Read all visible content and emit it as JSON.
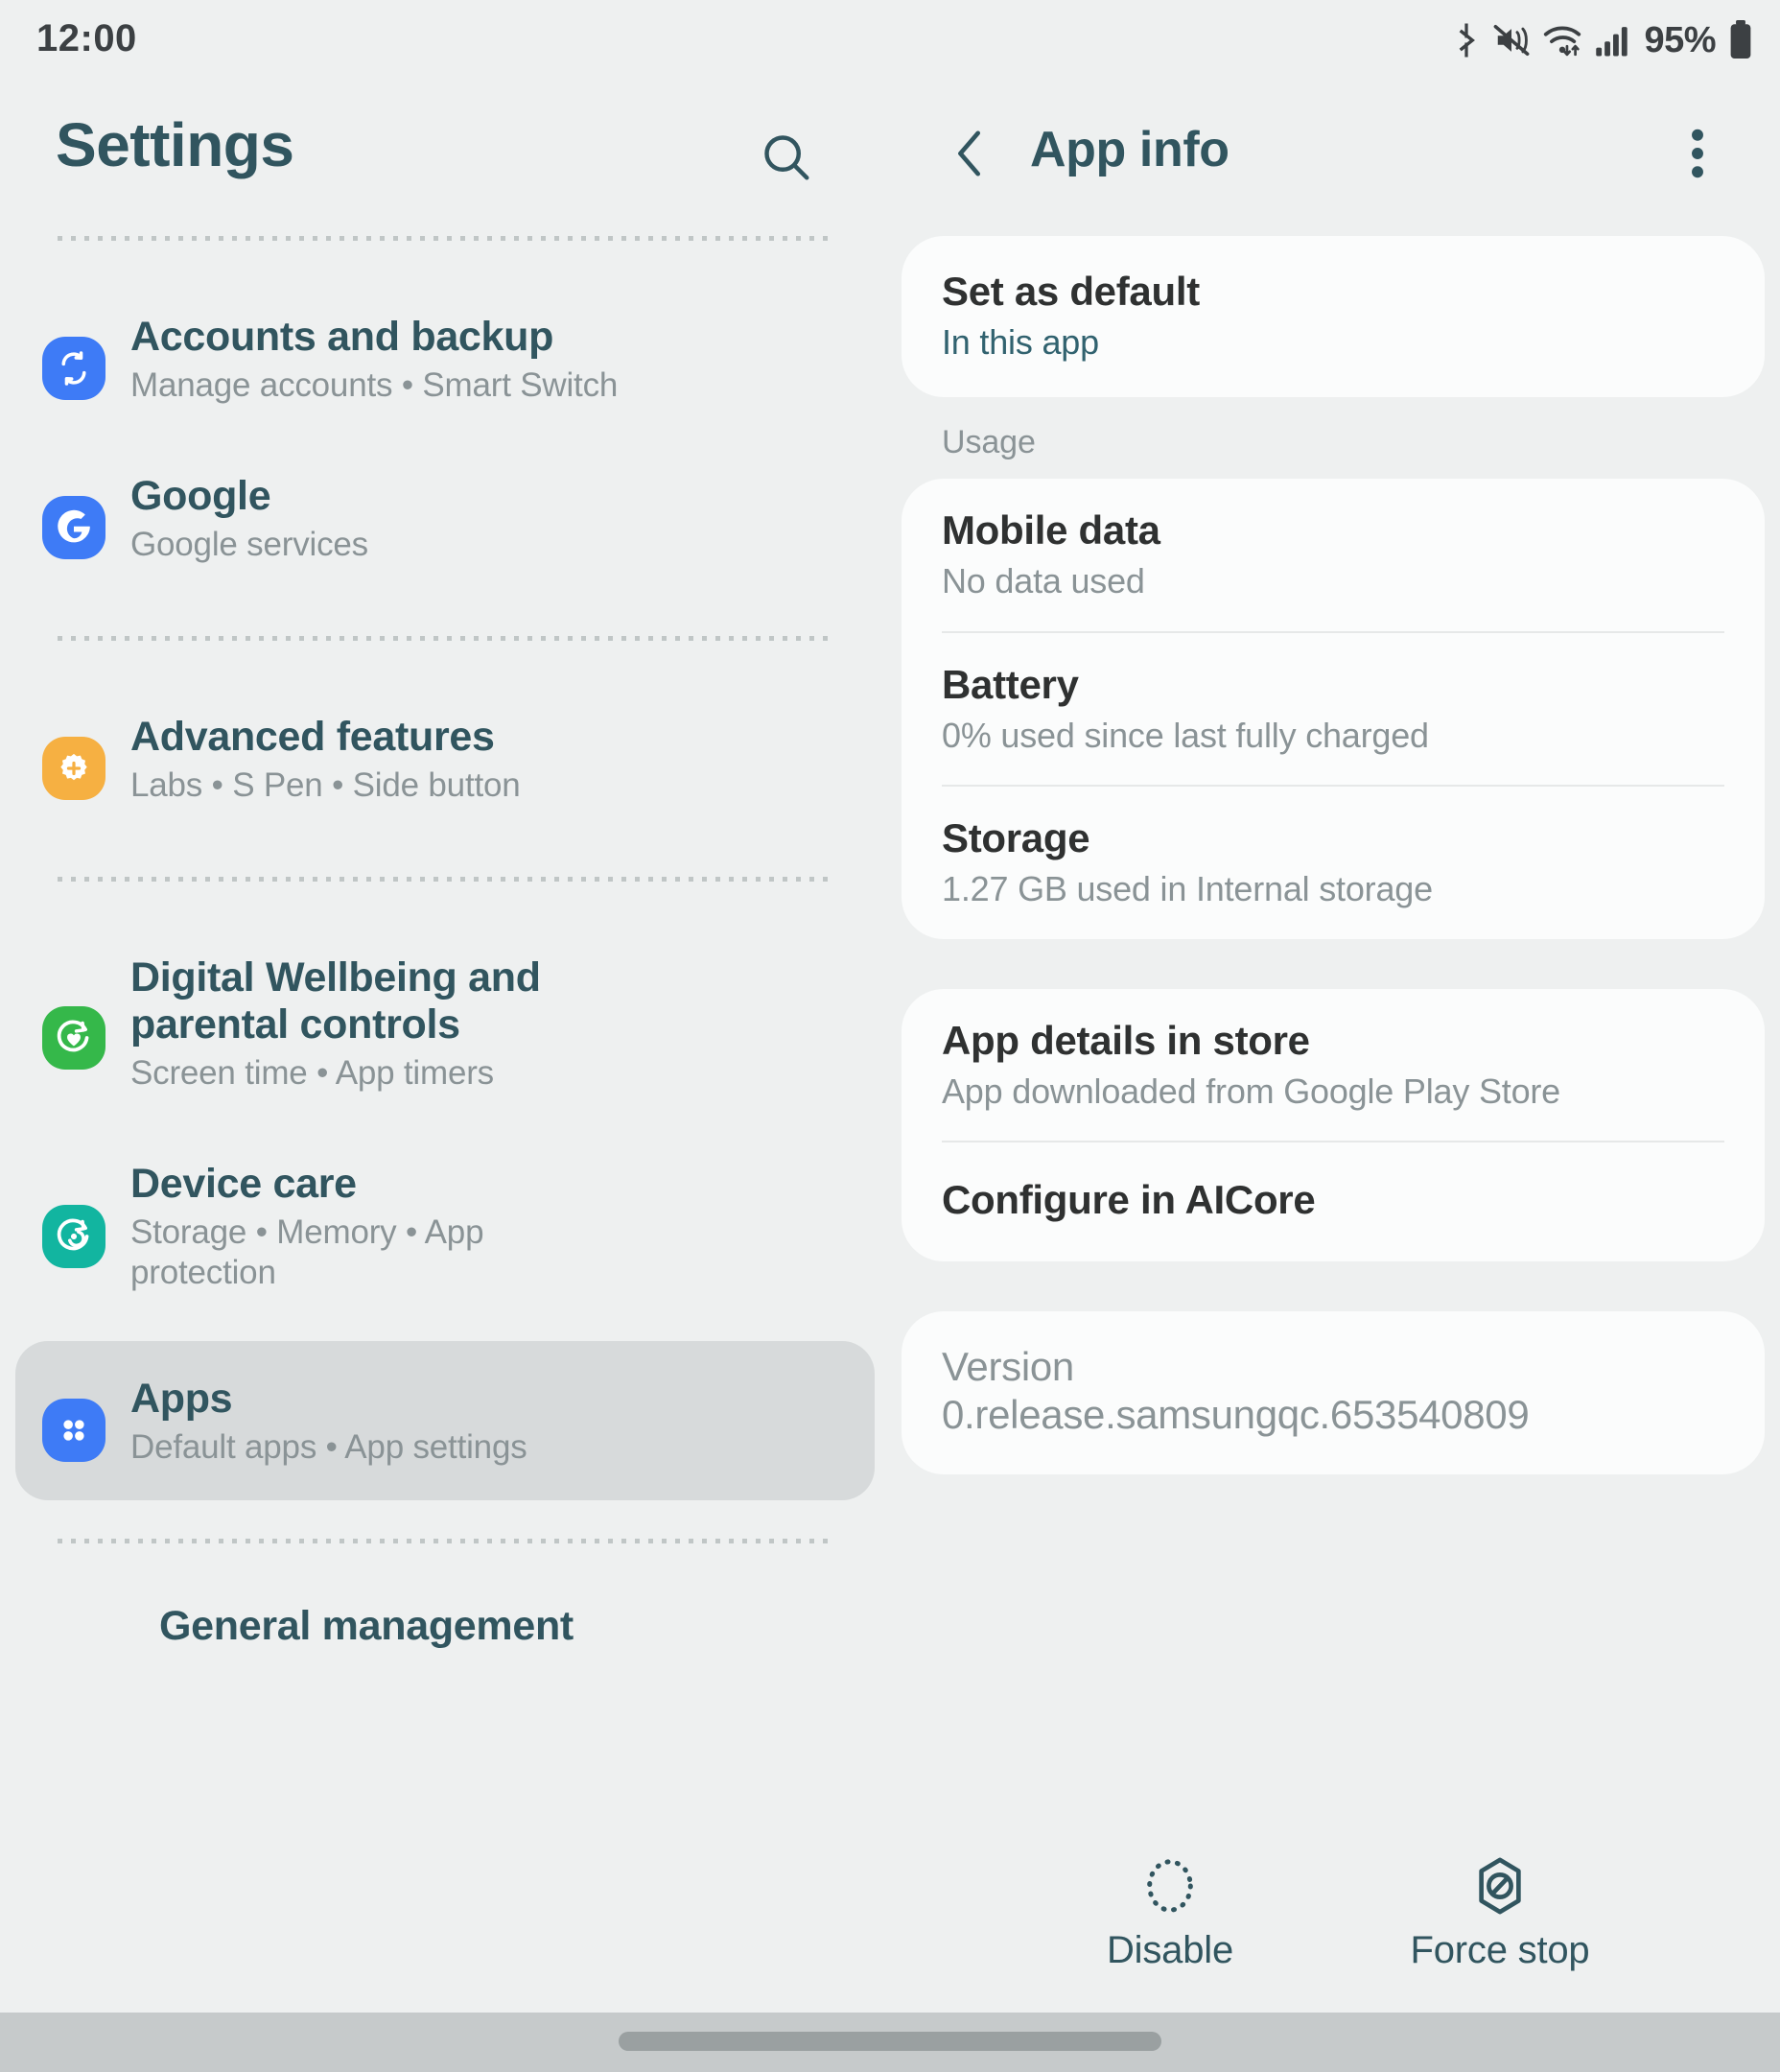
{
  "statusbar": {
    "time": "12:00",
    "battery_percent": "95%",
    "icons": [
      "bluetooth-icon",
      "mute-icon",
      "wifi-icon",
      "signal-icon",
      "battery-icon"
    ]
  },
  "sidebar": {
    "title": "Settings",
    "search_icon": "search-icon",
    "items": [
      {
        "label": "Accounts and backup",
        "sub": "Manage accounts  •  Smart Switch",
        "icon": "sync-icon",
        "color": "#3e7bf6",
        "selected": false
      },
      {
        "label": "Google",
        "sub": "Google services",
        "icon": "google-g-icon",
        "color": "#3e7bf6",
        "selected": false
      },
      {
        "label": "Advanced features",
        "sub": "Labs  •  S Pen  •  Side button",
        "icon": "gear-plus-icon",
        "color": "#f6b042",
        "selected": false
      },
      {
        "label": "Digital Wellbeing and parental controls",
        "sub": "Screen time  •  App timers",
        "icon": "heart-circle-icon",
        "color": "#35b84a",
        "selected": false
      },
      {
        "label": "Device care",
        "sub": "Storage  •  Memory  •  App protection",
        "icon": "device-care-icon",
        "color": "#12b5a0",
        "selected": false
      },
      {
        "label": "Apps",
        "sub": "Default apps  •  App settings",
        "icon": "apps-grid-icon",
        "color": "#3e7bf6",
        "selected": true
      },
      {
        "label": "General management",
        "sub": "",
        "icon": "",
        "color": "",
        "selected": false
      }
    ]
  },
  "detail": {
    "title": "App info",
    "back_icon": "chevron-left-icon",
    "more_icon": "more-vertical-icon",
    "default_card": {
      "title": "Set as default",
      "sub": "In this app"
    },
    "usage_label": "Usage",
    "usage_rows": [
      {
        "title": "Mobile data",
        "sub": "No data used"
      },
      {
        "title": "Battery",
        "sub": "0% used since last fully charged"
      },
      {
        "title": "Storage",
        "sub": "1.27 GB used in Internal storage"
      }
    ],
    "store_rows": [
      {
        "title": "App details in store",
        "sub": "App downloaded from Google Play Store"
      },
      {
        "title": "Configure in AICore",
        "sub": ""
      }
    ],
    "version": {
      "label": "Version",
      "value": "0.release.samsungqc.653540809"
    },
    "actions": [
      {
        "label": "Disable",
        "icon": "dotted-circle-icon"
      },
      {
        "label": "Force stop",
        "icon": "force-stop-icon"
      }
    ]
  },
  "colors": {
    "background": "#eef0f0",
    "accent_teal": "#31555f",
    "card": "#fbfcfc",
    "muted": "#8a9396",
    "selected_bg": "#d7dadb"
  }
}
